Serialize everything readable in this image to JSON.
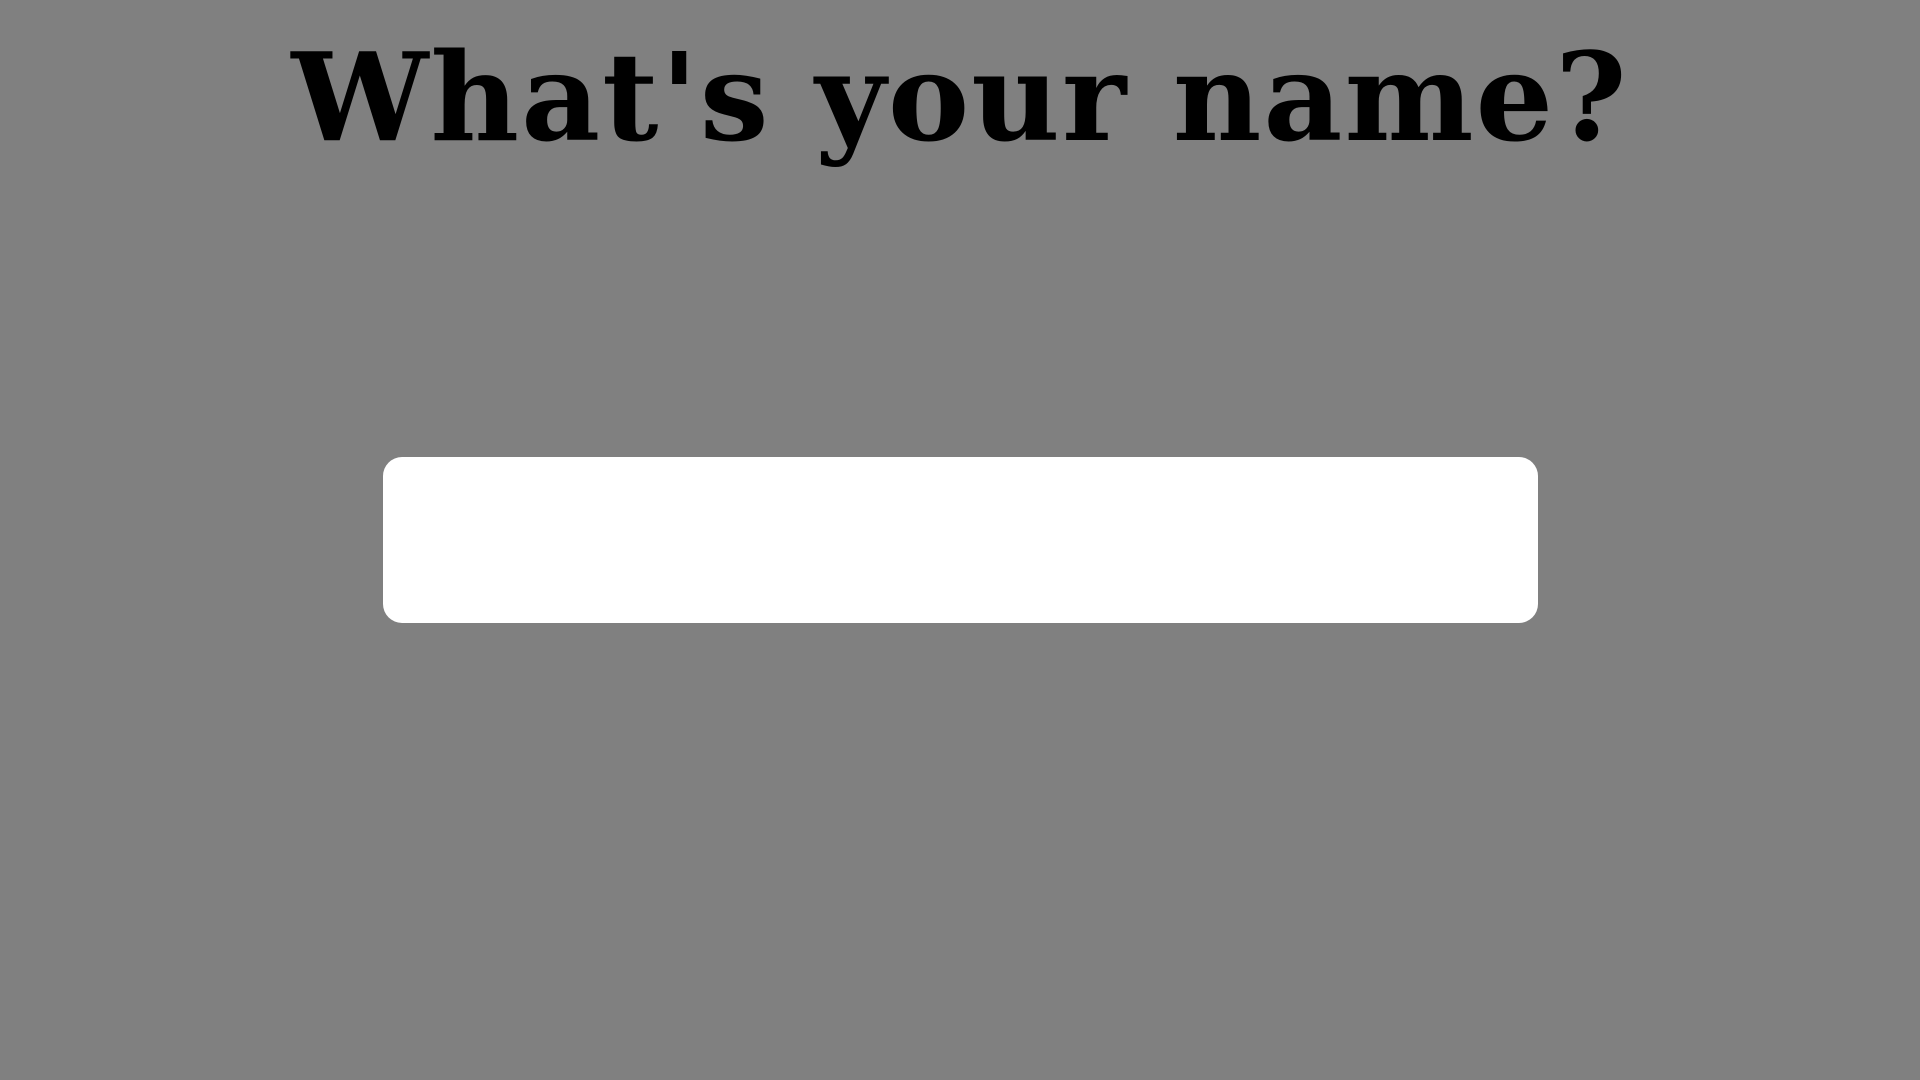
{
  "prompt": {
    "heading": "What's your name?"
  },
  "name_input": {
    "value": "",
    "placeholder": ""
  },
  "colors": {
    "background": "#808080",
    "heading_text": "#000000",
    "input_background": "#ffffff"
  }
}
